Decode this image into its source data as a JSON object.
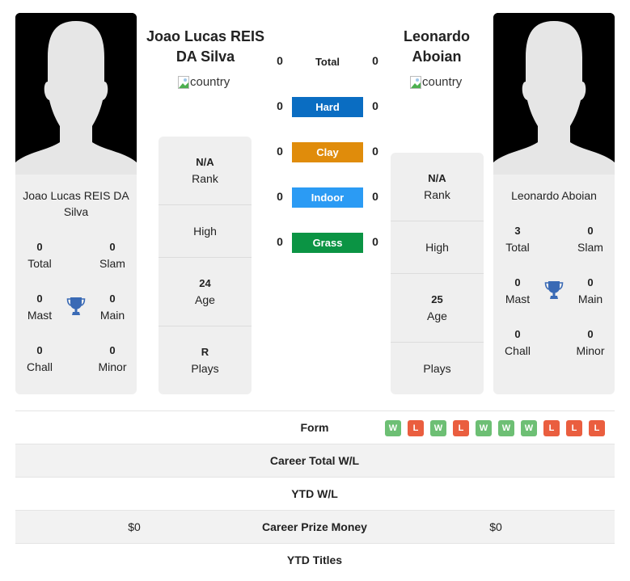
{
  "colors": {
    "hard": "#0a6dc2",
    "clay": "#e08c0b",
    "indoor": "#2b9bf4",
    "grass": "#0b9444",
    "win": "#6dbf74",
    "loss": "#ea5e3f",
    "trophy": "#3a6ab5"
  },
  "player1": {
    "name": "Joao Lucas REIS DA Silva",
    "heading_line1": "Joao Lucas REIS",
    "heading_line2": "DA Silva",
    "card_name_line1": "Joao Lucas REIS DA",
    "card_name_line2": "Silva",
    "country_alt": "country",
    "titles": {
      "total": "0",
      "total_label": "Total",
      "slam": "0",
      "slam_label": "Slam",
      "mast": "0",
      "mast_label": "Mast",
      "main": "0",
      "main_label": "Main",
      "chall": "0",
      "chall_label": "Chall",
      "minor": "0",
      "minor_label": "Minor"
    },
    "info": {
      "rank": "N/A",
      "rank_label": "Rank",
      "high": "",
      "high_label": "High",
      "age": "24",
      "age_label": "Age",
      "plays": "R",
      "plays_label": "Plays"
    }
  },
  "player2": {
    "name": "Leonardo Aboian",
    "heading_line1": "Leonardo",
    "heading_line2": "Aboian",
    "card_name_line1": "Leonardo Aboian",
    "country_alt": "country",
    "titles": {
      "total": "3",
      "total_label": "Total",
      "slam": "0",
      "slam_label": "Slam",
      "mast": "0",
      "mast_label": "Mast",
      "main": "0",
      "main_label": "Main",
      "chall": "0",
      "chall_label": "Chall",
      "minor": "0",
      "minor_label": "Minor"
    },
    "info": {
      "rank": "N/A",
      "rank_label": "Rank",
      "high": "",
      "high_label": "High",
      "age": "25",
      "age_label": "Age",
      "plays": "",
      "plays_label": "Plays"
    }
  },
  "h2h": {
    "total_label": "Total",
    "rows": [
      {
        "label": "Total",
        "p1": "0",
        "p2": "0"
      },
      {
        "label": "Hard",
        "p1": "0",
        "p2": "0"
      },
      {
        "label": "Clay",
        "p1": "0",
        "p2": "0"
      },
      {
        "label": "Indoor",
        "p1": "0",
        "p2": "0"
      },
      {
        "label": "Grass",
        "p1": "0",
        "p2": "0"
      }
    ]
  },
  "stats": {
    "form_label": "Form",
    "form": [
      "W",
      "L",
      "W",
      "L",
      "W",
      "W",
      "W",
      "L",
      "L",
      "L"
    ],
    "career_wl_label": "Career Total W/L",
    "career_wl_p1": "",
    "career_wl_p2": "",
    "ytd_wl_label": "YTD W/L",
    "ytd_wl_p1": "",
    "ytd_wl_p2": "",
    "prize_label": "Career Prize Money",
    "prize_p1": "$0",
    "prize_p2": "$0",
    "ytd_titles_label": "YTD Titles",
    "ytd_titles_p1": "",
    "ytd_titles_p2": ""
  }
}
